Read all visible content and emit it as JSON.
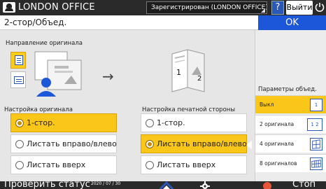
{
  "header": {
    "device_name": "LONDON OFFICE",
    "login_status": "Зарегистрирован (LONDON OFFICE)",
    "help_label": "?",
    "logout_label": "Выйти"
  },
  "titlebar": {
    "title": "2-стор/Объед.",
    "ok_label": "OK"
  },
  "orientation": {
    "label": "Направление оригинала"
  },
  "original_settings": {
    "label": "Настройка оригинала",
    "options": [
      "1-стор.",
      "Листать вправо/влево",
      "Листать вверх"
    ],
    "selected_index": 0
  },
  "print_side_settings": {
    "label": "Настройка печатной стороны",
    "options": [
      "1-стор.",
      "Листать вправо/влево",
      "Листать вверх"
    ],
    "selected_index": 1,
    "illustration_pages": [
      "1",
      "2"
    ]
  },
  "combine": {
    "label": "Параметры объед.",
    "items": [
      {
        "label": "Выкл",
        "icon": "1"
      },
      {
        "label": "2 оригинала",
        "icon": "1 2"
      },
      {
        "label": "4 оригинала",
        "icon": ""
      },
      {
        "label": "8 оригиналов",
        "icon": ""
      }
    ],
    "selected_index": 0
  },
  "footer": {
    "check_status_label": "Проверить статус",
    "date": "2020 / 07 / 30",
    "stop_label": "Стоп"
  },
  "colors": {
    "accent_blue": "#1c56d9",
    "selected_yellow": "#fbc61a",
    "header_dark": "#2a2a2a"
  },
  "icons": [
    "user-icon",
    "help-icon",
    "power-icon",
    "home-icon",
    "gear-icon",
    "stop-icon",
    "arrow-right-icon"
  ]
}
